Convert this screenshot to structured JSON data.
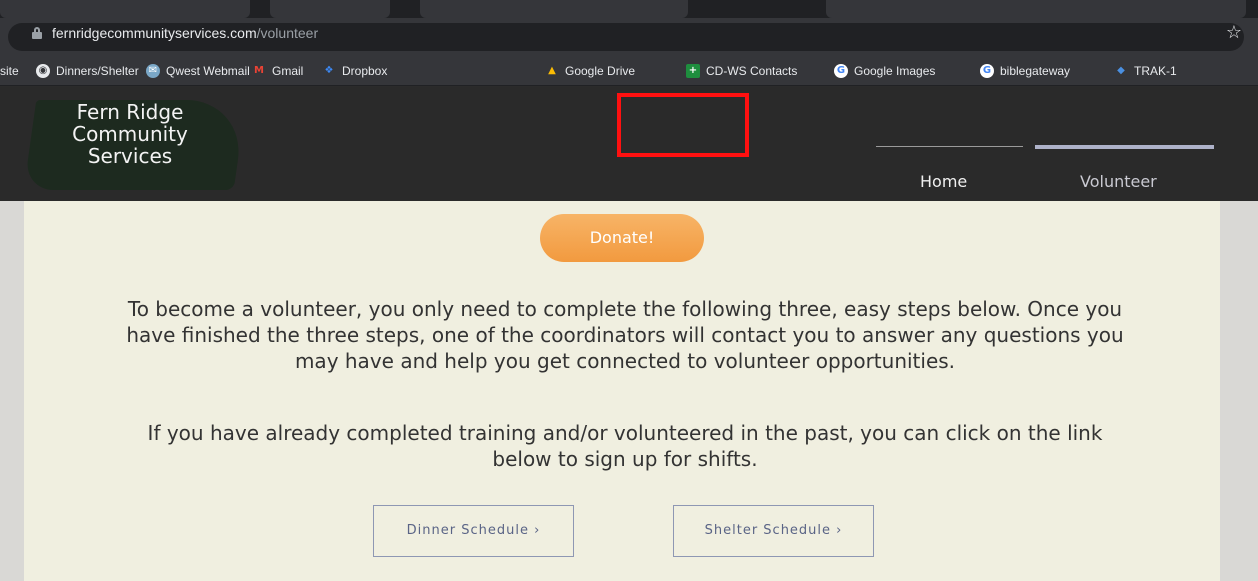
{
  "browser": {
    "url_domain": "fernridgecommunityservices.com",
    "url_path": "/volunteer",
    "bookmarks": [
      {
        "label": "site",
        "icon": "none"
      },
      {
        "label": "Dinners/Shelter",
        "icon": "globe-icon"
      },
      {
        "label": "Qwest Webmail",
        "icon": "webmail-icon"
      },
      {
        "label": "Gmail",
        "icon": "gmail-icon"
      },
      {
        "label": "Dropbox",
        "icon": "dropbox-icon"
      },
      {
        "label": "Google Drive",
        "icon": "google-drive-icon"
      },
      {
        "label": "CD-WS Contacts",
        "icon": "contacts-icon"
      },
      {
        "label": "Google Images",
        "icon": "google-icon"
      },
      {
        "label": "biblegateway",
        "icon": "google-icon"
      },
      {
        "label": "TRAK-1",
        "icon": "trak-icon"
      }
    ]
  },
  "site": {
    "logo_lines": [
      "Fern Ridge",
      "Community",
      "Services"
    ],
    "nav": {
      "home": "Home",
      "volunteer": "Volunteer"
    },
    "donate": "Donate!",
    "paragraph1": "To become a volunteer, you only need to complete the following three, easy steps below. Once you have finished the three steps, one of the coordinators will contact you to answer any questions you may have and help you get connected to volunteer opportunities.",
    "paragraph2": "If you have already completed training and/or volunteered in the past, you can click on the link below to sign up for shifts.",
    "buttons": {
      "dinner": "Dinner Schedule ›",
      "shelter": "Shelter Schedule ›"
    }
  },
  "colors": {
    "accent_orange": "#f29a3f",
    "highlight_red": "#ff1010",
    "panel": "#f0efe0",
    "header": "#2a2a2a"
  }
}
